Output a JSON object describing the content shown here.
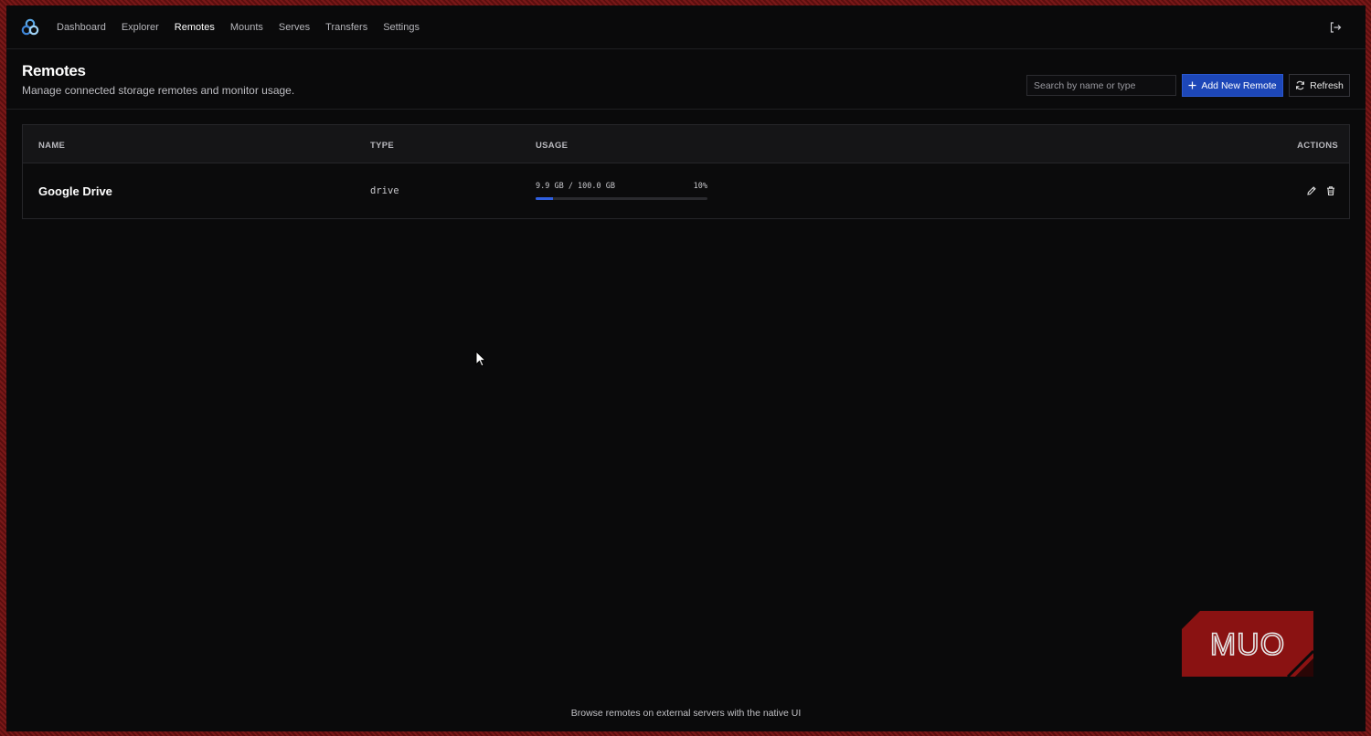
{
  "nav": {
    "items": [
      {
        "label": "Dashboard",
        "active": false
      },
      {
        "label": "Explorer",
        "active": false
      },
      {
        "label": "Remotes",
        "active": true
      },
      {
        "label": "Mounts",
        "active": false
      },
      {
        "label": "Serves",
        "active": false
      },
      {
        "label": "Transfers",
        "active": false
      },
      {
        "label": "Settings",
        "active": false
      }
    ],
    "logo_icon": "rclone-logo-icon",
    "logout_icon": "logout-icon"
  },
  "header": {
    "title": "Remotes",
    "subtitle": "Manage connected storage remotes and monitor usage.",
    "search_placeholder": "Search by name or type",
    "add_label": "Add New Remote",
    "refresh_label": "Refresh"
  },
  "table": {
    "columns": {
      "name": "NAME",
      "type": "TYPE",
      "usage": "USAGE",
      "actions": "ACTIONS"
    },
    "rows": [
      {
        "name": "Google Drive",
        "type": "drive",
        "usage_text": "9.9 GB / 100.0 GB",
        "usage_percent_text": "10%",
        "usage_fraction": 0.099
      }
    ]
  },
  "footer": {
    "link": "Browse remotes on external servers with the native UI"
  },
  "watermark": {
    "text": "MUO"
  },
  "colors": {
    "accent": "#1d47b8",
    "background": "#0a0a0b",
    "progress": "#2f5fe0"
  }
}
